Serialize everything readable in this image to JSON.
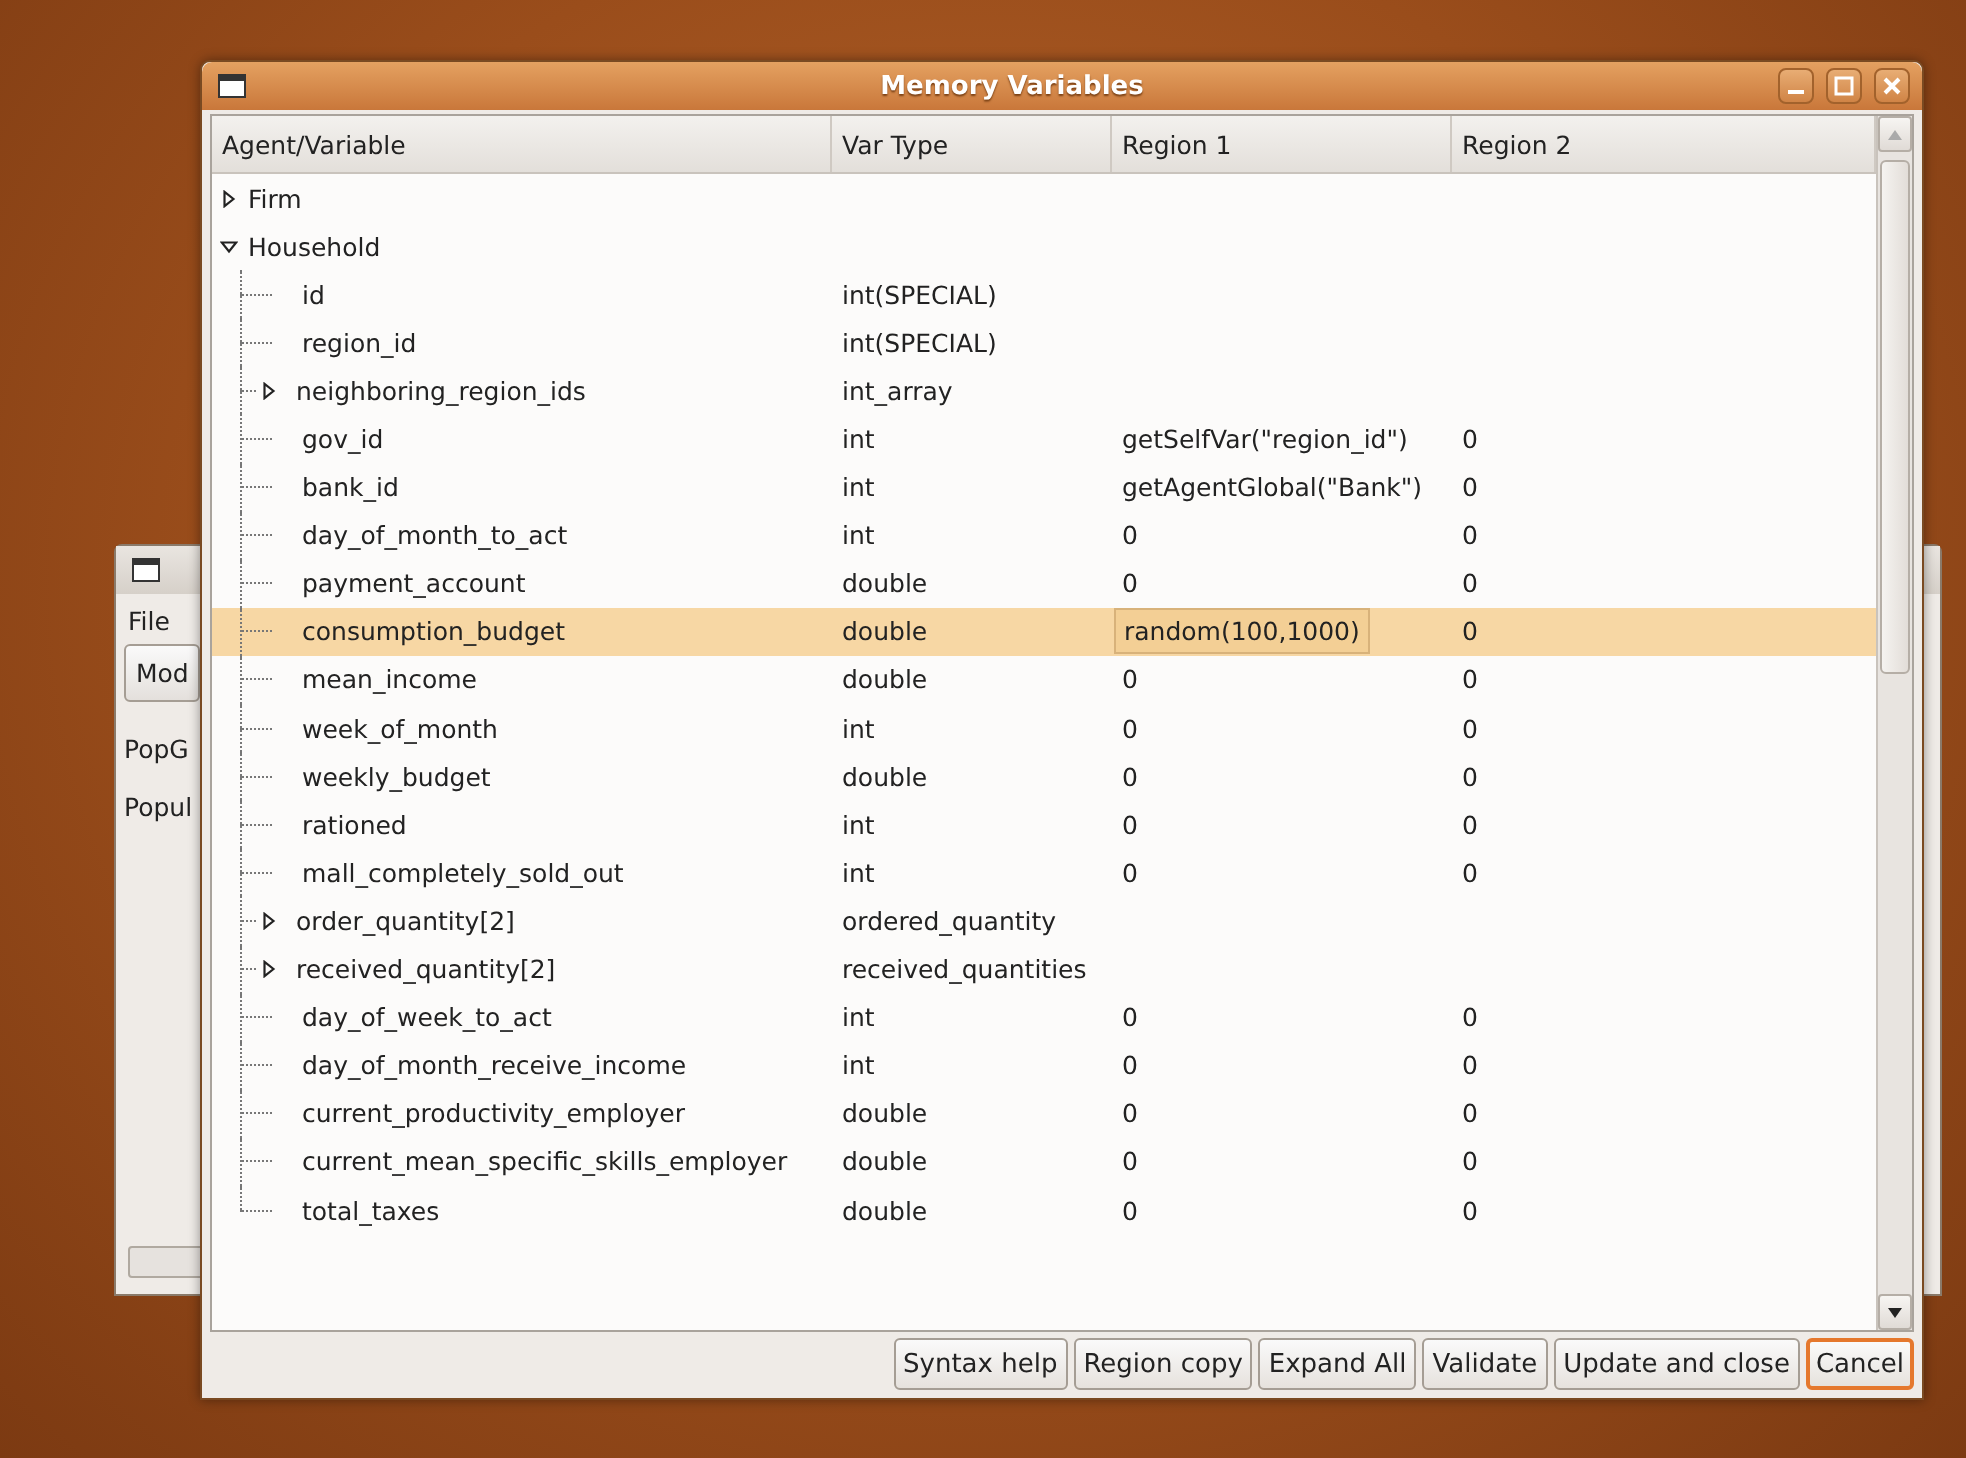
{
  "back_window": {
    "menu": [
      "File"
    ],
    "button": "Mod",
    "labels": [
      "PopG",
      "Popul"
    ]
  },
  "window": {
    "title": "Memory Variables"
  },
  "columns": [
    "Agent/Variable",
    "Var Type",
    "Region 1",
    "Region 2"
  ],
  "agents": [
    {
      "name": "Firm",
      "expanded": false
    },
    {
      "name": "Household",
      "expanded": true,
      "children": [
        {
          "name": "id",
          "kind": "leaf",
          "var_type": "int(SPECIAL)",
          "selected": false
        },
        {
          "name": "region_id",
          "kind": "leaf",
          "var_type": "int(SPECIAL)",
          "selected": false
        },
        {
          "name": "neighboring_region_ids",
          "kind": "branch",
          "expanded": false,
          "var_type": "int_array",
          "selected": false
        },
        {
          "name": "gov_id",
          "kind": "leaf",
          "var_type": "int",
          "region_1": "getSelfVar(\"region_id\")",
          "region_2": "0",
          "selected": false
        },
        {
          "name": "bank_id",
          "kind": "leaf",
          "var_type": "int",
          "region_1": "getAgentGlobal(\"Bank\")",
          "region_2": "0",
          "selected": false
        },
        {
          "name": "day_of_month_to_act",
          "kind": "leaf",
          "var_type": "int",
          "region_1": "0",
          "region_2": "0",
          "selected": false
        },
        {
          "name": "payment_account",
          "kind": "leaf",
          "var_type": "double",
          "region_1": "0",
          "region_2": "0",
          "selected": false
        },
        {
          "name": "consumption_budget",
          "kind": "leaf",
          "var_type": "double",
          "region_1": "random(100,1000)",
          "region_2": "0",
          "selected": true
        },
        {
          "name": "mean_income",
          "kind": "leaf",
          "var_type": "double",
          "region_1": "0",
          "region_2": "0",
          "selected": false
        },
        {
          "name": "week_of_month",
          "kind": "leaf",
          "var_type": "int",
          "region_1": "0",
          "region_2": "0",
          "selected": false
        },
        {
          "name": "weekly_budget",
          "kind": "leaf",
          "var_type": "double",
          "region_1": "0",
          "region_2": "0",
          "selected": false
        },
        {
          "name": "rationed",
          "kind": "leaf",
          "var_type": "int",
          "region_1": "0",
          "region_2": "0",
          "selected": false
        },
        {
          "name": "mall_completely_sold_out",
          "kind": "leaf",
          "var_type": "int",
          "region_1": "0",
          "region_2": "0",
          "selected": false
        },
        {
          "name": "order_quantity[2]",
          "kind": "branch",
          "expanded": false,
          "var_type": "ordered_quantity",
          "selected": false
        },
        {
          "name": "received_quantity[2]",
          "kind": "branch",
          "expanded": false,
          "var_type": "received_quantities",
          "selected": false
        },
        {
          "name": "day_of_week_to_act",
          "kind": "leaf",
          "var_type": "int",
          "region_1": "0",
          "region_2": "0",
          "selected": false
        },
        {
          "name": "day_of_month_receive_income",
          "kind": "leaf",
          "var_type": "int",
          "region_1": "0",
          "region_2": "0",
          "selected": false
        },
        {
          "name": "current_productivity_employer",
          "kind": "leaf",
          "var_type": "double",
          "region_1": "0",
          "region_2": "0",
          "selected": false
        },
        {
          "name": "current_mean_specific_skills_employer",
          "kind": "leaf",
          "var_type": "double",
          "region_1": "0",
          "region_2": "0",
          "selected": false
        },
        {
          "name": "total_taxes",
          "kind": "leaf",
          "var_type": "double",
          "region_1": "0",
          "region_2": "0",
          "selected": false
        }
      ]
    }
  ],
  "buttons": [
    {
      "label": "Syntax help",
      "focused": false
    },
    {
      "label": "Region copy",
      "focused": false
    },
    {
      "label": "Expand All",
      "focused": false
    },
    {
      "label": "Validate",
      "focused": false
    },
    {
      "label": "Update and close",
      "focused": false
    },
    {
      "label": "Cancel",
      "focused": true
    }
  ]
}
